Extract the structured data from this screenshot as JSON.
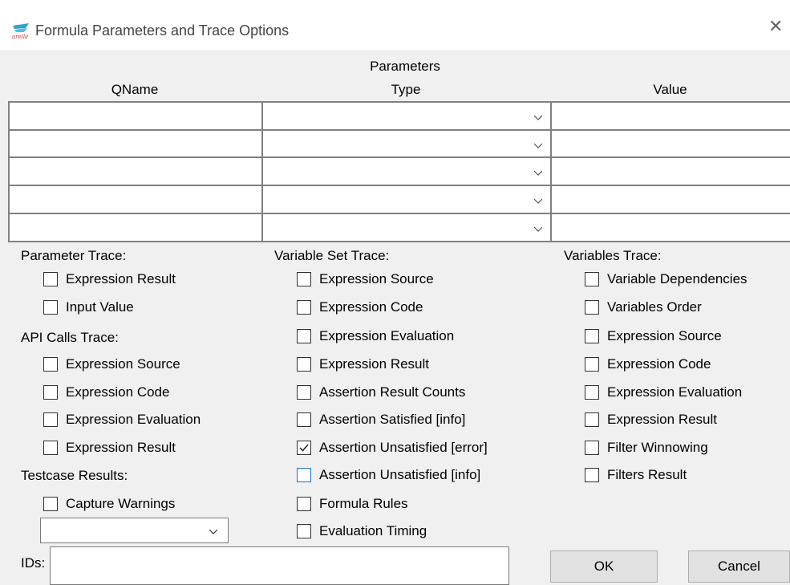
{
  "window": {
    "title": "Formula Parameters and Trace Options"
  },
  "parameters": {
    "title": "Parameters",
    "col_qname": "QName",
    "col_type": "Type",
    "col_value": "Value",
    "rows": [
      {
        "qname": "",
        "type": "",
        "value": ""
      },
      {
        "qname": "",
        "type": "",
        "value": ""
      },
      {
        "qname": "",
        "type": "",
        "value": ""
      },
      {
        "qname": "",
        "type": "",
        "value": ""
      },
      {
        "qname": "",
        "type": "",
        "value": ""
      }
    ]
  },
  "parameter_trace": {
    "label": "Parameter Trace:",
    "expression_result": "Expression Result",
    "input_value": "Input Value"
  },
  "api_calls_trace": {
    "label": "API Calls Trace:",
    "expression_source": "Expression Source",
    "expression_code": "Expression Code",
    "expression_evaluation": "Expression Evaluation",
    "expression_result": "Expression Result"
  },
  "testcase_results": {
    "label": "Testcase Results:",
    "capture_warnings": "Capture Warnings",
    "select_value": ""
  },
  "variable_set_trace": {
    "label": "Variable Set Trace:",
    "expression_source": "Expression Source",
    "expression_code": "Expression Code",
    "expression_evaluation": "Expression Evaluation",
    "expression_result": "Expression Result",
    "assertion_result_counts": "Assertion Result Counts",
    "assertion_satisfied_info": "Assertion Satisfied [info]",
    "assertion_unsatisfied_error": "Assertion Unsatisfied [error]",
    "assertion_unsatisfied_info": "Assertion Unsatisfied [info]",
    "formula_rules": "Formula Rules",
    "evaluation_timing": "Evaluation Timing"
  },
  "variables_trace": {
    "label": "Variables Trace:",
    "variable_dependencies": "Variable Dependencies",
    "variables_order": "Variables Order",
    "expression_source": "Expression Source",
    "expression_code": "Expression Code",
    "expression_evaluation": "Expression Evaluation",
    "expression_result": "Expression Result",
    "filter_winnowing": "Filter Winnowing",
    "filters_result": "Filters Result"
  },
  "ids": {
    "label": "IDs:",
    "value": ""
  },
  "buttons": {
    "ok": "OK",
    "cancel": "Cancel"
  },
  "checked": {
    "assertion_unsatisfied_error": true
  }
}
